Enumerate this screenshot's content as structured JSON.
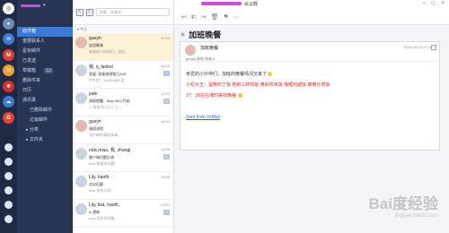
{
  "window": {
    "title": "会议概"
  },
  "sidebar": {
    "items": [
      {
        "label": "收件箱",
        "active": true
      },
      {
        "label": "重要联系人"
      },
      {
        "label": "星标邮件"
      },
      {
        "label": "已发送"
      },
      {
        "label": "草稿箱"
      },
      {
        "label": "删除件夹"
      },
      {
        "label": "日历"
      },
      {
        "label": "通讯录"
      },
      {
        "label": "已删除邮件"
      },
      {
        "label": "垃圾邮件"
      },
      {
        "label": "分类"
      },
      {
        "label": "文件夹"
      }
    ],
    "badges": {
      "drafts": "12"
    }
  },
  "list": {
    "search_placeholder": "搜索：关键字",
    "group_today": "今天",
    "messages": [
      {
        "from": "guoyh",
        "time": "17:14",
        "subject": "加班晚餐",
        "preview": "亲爱的小伙伴们，加班..."
      },
      {
        "from": "我, rj_fankol",
        "time": "16:13",
        "subject": "答复: 答复修改版万JUE",
        "preview": "中午你：Sun99906 会..."
      },
      {
        "from": "jade",
        "time": "12:22",
        "subject": "周报提醒：Mac 0912开始",
        "preview": "1, 版本号0.0.17 上..."
      },
      {
        "from": "guoyh",
        "time": "12:02",
        "subject": "请假流程",
        "preview": "用户邮件请假申请..."
      },
      {
        "from": "nick.miao, 我, zhangl",
        "time": "11:06",
        "subject": "客户端问题反馈",
        "preview": "Mac 新版本问题"
      },
      {
        "from": "Lily, haoth",
        "time": "10:30",
        "subject": "会议纪要",
        "preview": "Mac 发布计划"
      },
      {
        "from": "Lily, lisa, haoth,",
        "time": "10:01",
        "subject": "ui 更新",
        "preview": "mac 同步的功能..."
      }
    ]
  },
  "reader": {
    "subject": "加班晚餐",
    "card": {
      "subject": "加班晚餐",
      "date": "2016-09-13 17:14",
      "meta": "guoyh  发给  所有人",
      "greeting": "亲爱的小伙伴们，加班的晚餐情况又来了",
      "red_line": "小杞大王：蛋糕鸡丁饭 桂莉三杯鸡饭 黄焖鸡米饭 咖喱鸡腿饭 蔬菜炒肉饭",
      "time_line": "17：30左右准时来收晚餐",
      "link": "Sent from YoMail"
    }
  },
  "watermark": {
    "brand": "Bai度经验",
    "url": "jingyan.baidu.com"
  },
  "colors": {
    "rail": "#1f2a44",
    "sidebar": "#273454",
    "accent": "#3b7bd8",
    "selected": "#fdf1d6"
  }
}
